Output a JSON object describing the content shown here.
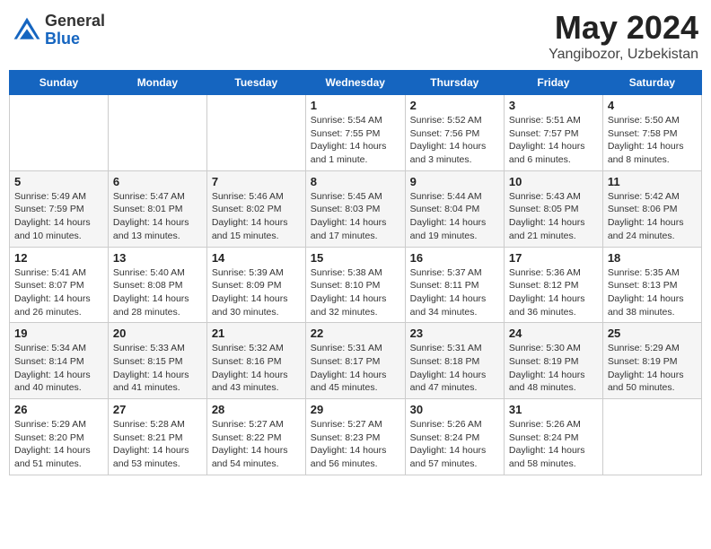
{
  "header": {
    "logo_general": "General",
    "logo_blue": "Blue",
    "month_title": "May 2024",
    "location": "Yangibozor, Uzbekistan"
  },
  "days_of_week": [
    "Sunday",
    "Monday",
    "Tuesday",
    "Wednesday",
    "Thursday",
    "Friday",
    "Saturday"
  ],
  "weeks": [
    [
      {
        "day": "",
        "info": ""
      },
      {
        "day": "",
        "info": ""
      },
      {
        "day": "",
        "info": ""
      },
      {
        "day": "1",
        "info": "Sunrise: 5:54 AM\nSunset: 7:55 PM\nDaylight: 14 hours\nand 1 minute."
      },
      {
        "day": "2",
        "info": "Sunrise: 5:52 AM\nSunset: 7:56 PM\nDaylight: 14 hours\nand 3 minutes."
      },
      {
        "day": "3",
        "info": "Sunrise: 5:51 AM\nSunset: 7:57 PM\nDaylight: 14 hours\nand 6 minutes."
      },
      {
        "day": "4",
        "info": "Sunrise: 5:50 AM\nSunset: 7:58 PM\nDaylight: 14 hours\nand 8 minutes."
      }
    ],
    [
      {
        "day": "5",
        "info": "Sunrise: 5:49 AM\nSunset: 7:59 PM\nDaylight: 14 hours\nand 10 minutes."
      },
      {
        "day": "6",
        "info": "Sunrise: 5:47 AM\nSunset: 8:01 PM\nDaylight: 14 hours\nand 13 minutes."
      },
      {
        "day": "7",
        "info": "Sunrise: 5:46 AM\nSunset: 8:02 PM\nDaylight: 14 hours\nand 15 minutes."
      },
      {
        "day": "8",
        "info": "Sunrise: 5:45 AM\nSunset: 8:03 PM\nDaylight: 14 hours\nand 17 minutes."
      },
      {
        "day": "9",
        "info": "Sunrise: 5:44 AM\nSunset: 8:04 PM\nDaylight: 14 hours\nand 19 minutes."
      },
      {
        "day": "10",
        "info": "Sunrise: 5:43 AM\nSunset: 8:05 PM\nDaylight: 14 hours\nand 21 minutes."
      },
      {
        "day": "11",
        "info": "Sunrise: 5:42 AM\nSunset: 8:06 PM\nDaylight: 14 hours\nand 24 minutes."
      }
    ],
    [
      {
        "day": "12",
        "info": "Sunrise: 5:41 AM\nSunset: 8:07 PM\nDaylight: 14 hours\nand 26 minutes."
      },
      {
        "day": "13",
        "info": "Sunrise: 5:40 AM\nSunset: 8:08 PM\nDaylight: 14 hours\nand 28 minutes."
      },
      {
        "day": "14",
        "info": "Sunrise: 5:39 AM\nSunset: 8:09 PM\nDaylight: 14 hours\nand 30 minutes."
      },
      {
        "day": "15",
        "info": "Sunrise: 5:38 AM\nSunset: 8:10 PM\nDaylight: 14 hours\nand 32 minutes."
      },
      {
        "day": "16",
        "info": "Sunrise: 5:37 AM\nSunset: 8:11 PM\nDaylight: 14 hours\nand 34 minutes."
      },
      {
        "day": "17",
        "info": "Sunrise: 5:36 AM\nSunset: 8:12 PM\nDaylight: 14 hours\nand 36 minutes."
      },
      {
        "day": "18",
        "info": "Sunrise: 5:35 AM\nSunset: 8:13 PM\nDaylight: 14 hours\nand 38 minutes."
      }
    ],
    [
      {
        "day": "19",
        "info": "Sunrise: 5:34 AM\nSunset: 8:14 PM\nDaylight: 14 hours\nand 40 minutes."
      },
      {
        "day": "20",
        "info": "Sunrise: 5:33 AM\nSunset: 8:15 PM\nDaylight: 14 hours\nand 41 minutes."
      },
      {
        "day": "21",
        "info": "Sunrise: 5:32 AM\nSunset: 8:16 PM\nDaylight: 14 hours\nand 43 minutes."
      },
      {
        "day": "22",
        "info": "Sunrise: 5:31 AM\nSunset: 8:17 PM\nDaylight: 14 hours\nand 45 minutes."
      },
      {
        "day": "23",
        "info": "Sunrise: 5:31 AM\nSunset: 8:18 PM\nDaylight: 14 hours\nand 47 minutes."
      },
      {
        "day": "24",
        "info": "Sunrise: 5:30 AM\nSunset: 8:19 PM\nDaylight: 14 hours\nand 48 minutes."
      },
      {
        "day": "25",
        "info": "Sunrise: 5:29 AM\nSunset: 8:19 PM\nDaylight: 14 hours\nand 50 minutes."
      }
    ],
    [
      {
        "day": "26",
        "info": "Sunrise: 5:29 AM\nSunset: 8:20 PM\nDaylight: 14 hours\nand 51 minutes."
      },
      {
        "day": "27",
        "info": "Sunrise: 5:28 AM\nSunset: 8:21 PM\nDaylight: 14 hours\nand 53 minutes."
      },
      {
        "day": "28",
        "info": "Sunrise: 5:27 AM\nSunset: 8:22 PM\nDaylight: 14 hours\nand 54 minutes."
      },
      {
        "day": "29",
        "info": "Sunrise: 5:27 AM\nSunset: 8:23 PM\nDaylight: 14 hours\nand 56 minutes."
      },
      {
        "day": "30",
        "info": "Sunrise: 5:26 AM\nSunset: 8:24 PM\nDaylight: 14 hours\nand 57 minutes."
      },
      {
        "day": "31",
        "info": "Sunrise: 5:26 AM\nSunset: 8:24 PM\nDaylight: 14 hours\nand 58 minutes."
      },
      {
        "day": "",
        "info": ""
      }
    ]
  ]
}
